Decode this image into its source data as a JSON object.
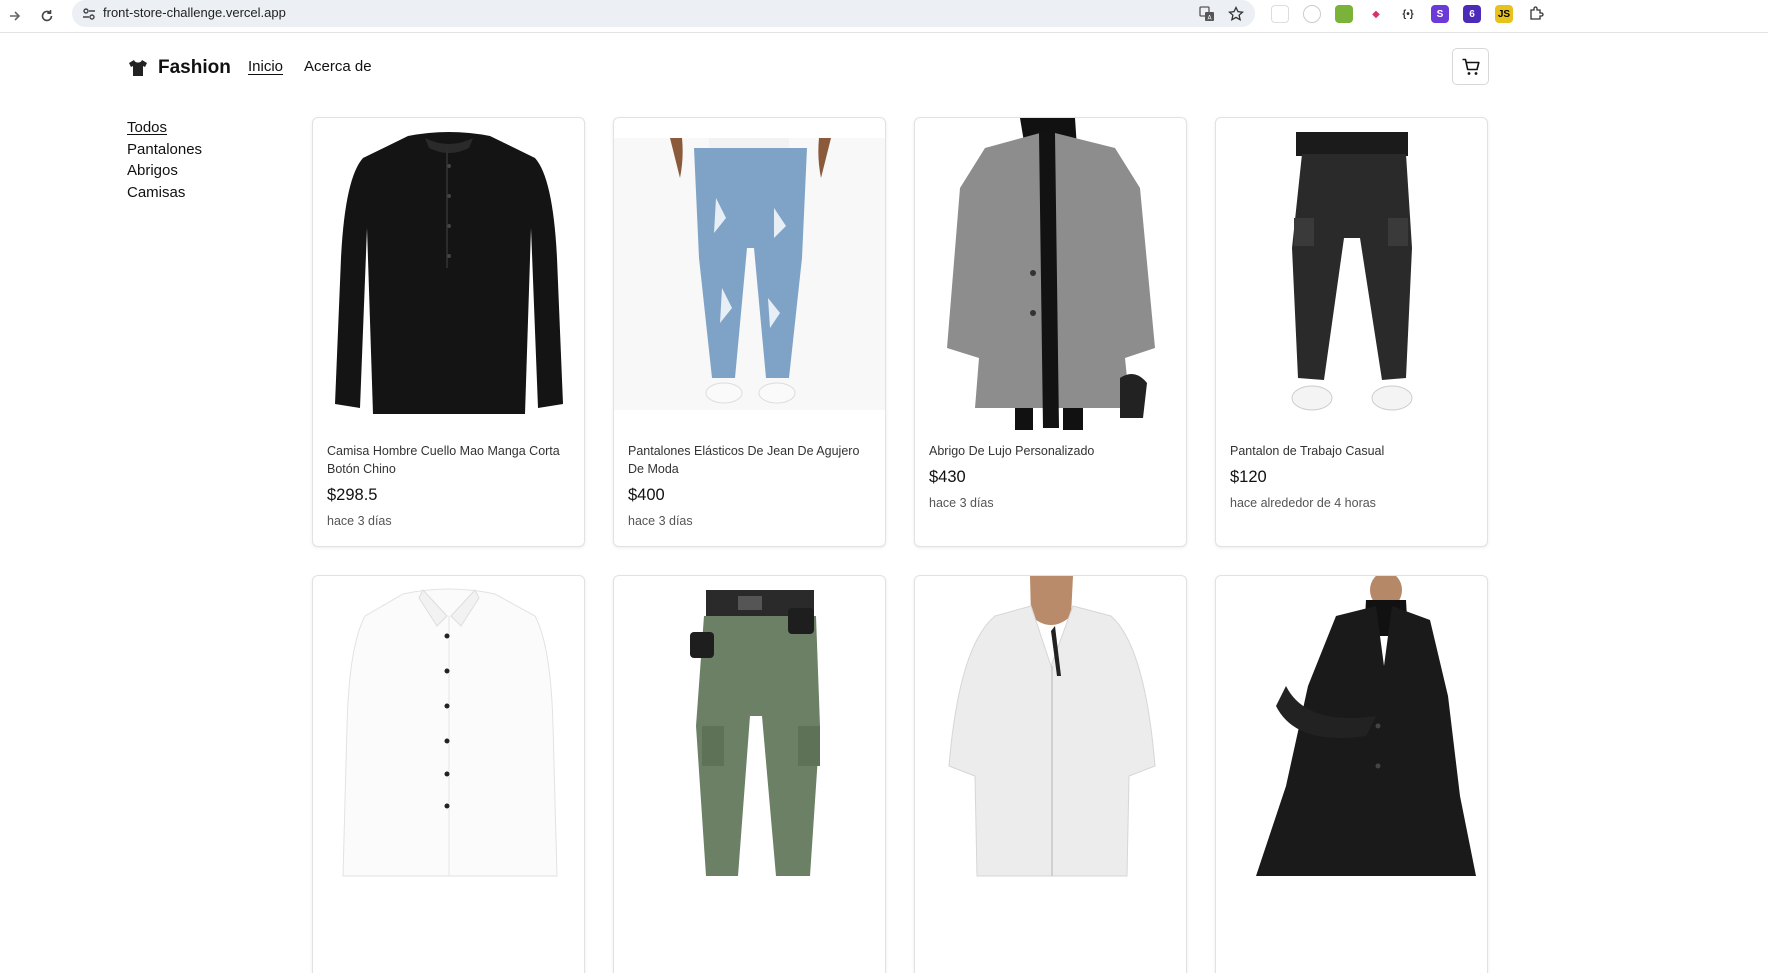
{
  "browser": {
    "url": "front-store-challenge.vercel.app"
  },
  "header": {
    "brand": "Fashion",
    "nav": [
      {
        "label": "Inicio",
        "active": true
      },
      {
        "label": "Acerca de",
        "active": false
      }
    ]
  },
  "sidebar": {
    "categories": [
      {
        "label": "Todos",
        "active": true
      },
      {
        "label": "Pantalones",
        "active": false
      },
      {
        "label": "Abrigos",
        "active": false
      },
      {
        "label": "Camisas",
        "active": false
      }
    ]
  },
  "products": [
    {
      "name": "Camisa Hombre Cuello Mao Manga Corta Botón Chino",
      "price": "$298.5",
      "time": "hace 3 días",
      "image": "black-henley-shirt"
    },
    {
      "name": "Pantalones Elásticos De Jean De Agujero De Moda",
      "price": "$400",
      "time": "hace 3 días",
      "image": "ripped-jeans"
    },
    {
      "name": "Abrigo De Lujo Personalizado",
      "price": "$430",
      "time": "hace 3 días",
      "image": "grey-coat"
    },
    {
      "name": "Pantalon de Trabajo Casual",
      "price": "$120",
      "time": "hace alrededor de 4 horas",
      "image": "black-cargo-pants"
    },
    {
      "name": "",
      "price": "",
      "time": "",
      "image": "white-dress-shirt"
    },
    {
      "name": "",
      "price": "",
      "time": "",
      "image": "green-cargo-pants"
    },
    {
      "name": "",
      "price": "",
      "time": "",
      "image": "white-linen-shirt"
    },
    {
      "name": "",
      "price": "",
      "time": "",
      "image": "black-long-coat"
    }
  ]
}
